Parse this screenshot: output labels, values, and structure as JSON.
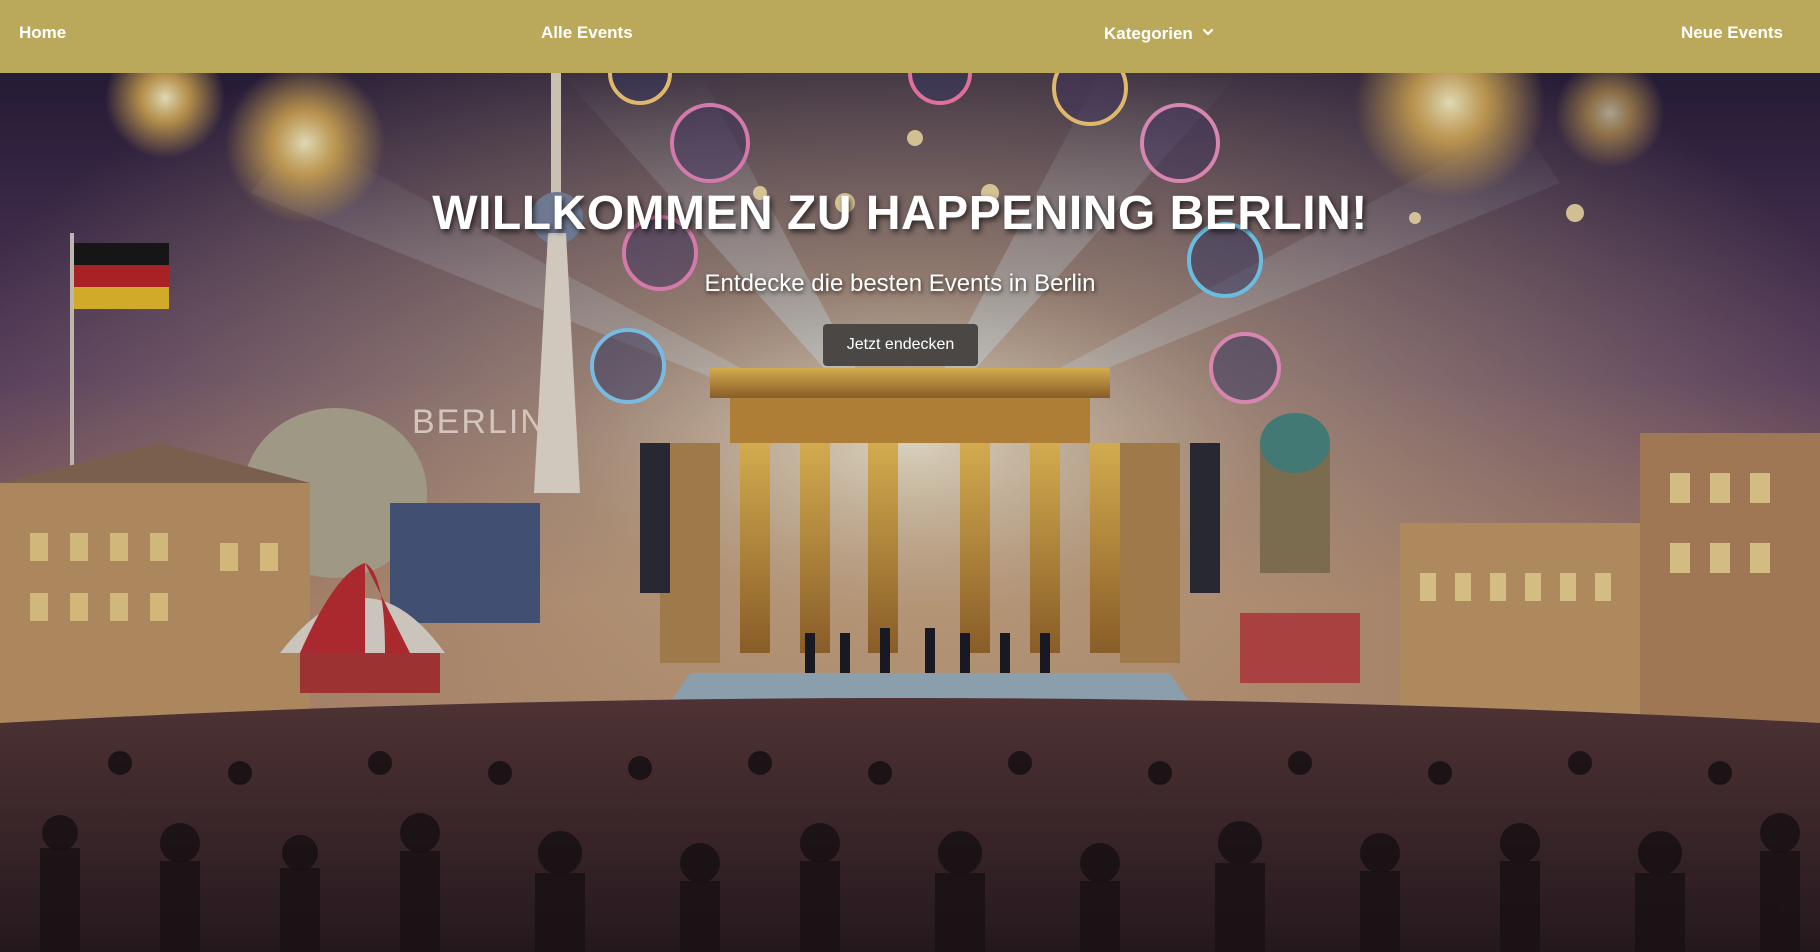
{
  "navbar": {
    "items": [
      {
        "label": "Home"
      },
      {
        "label": "Alle Events"
      },
      {
        "label": "Kategorien",
        "has_dropdown": true
      },
      {
        "label": "Neue Events"
      }
    ],
    "background": "#bba95b"
  },
  "hero": {
    "title": "WILLKOMMEN ZU HAPPENING BERLIN!",
    "subtitle": "Entdecke die besten Events in Berlin",
    "cta_label": "Jetzt endecken",
    "image_signs": {
      "berlin": "BERLIN"
    }
  }
}
